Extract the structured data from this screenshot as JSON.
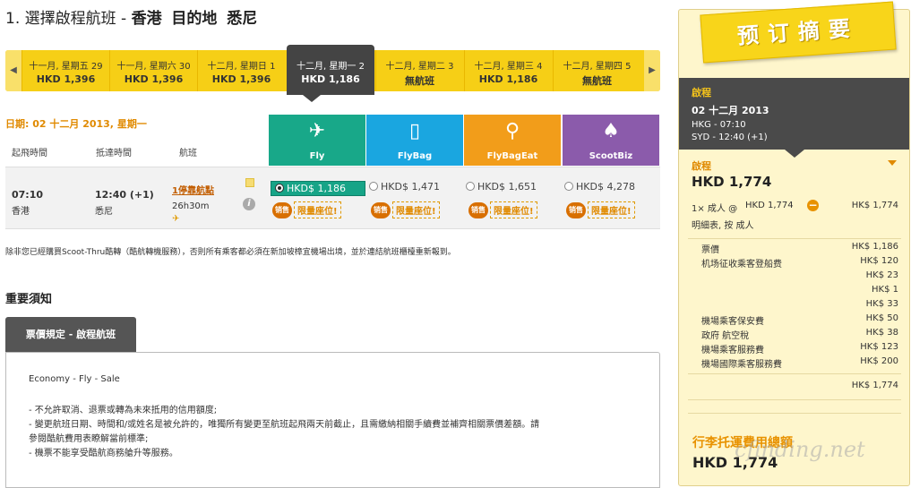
{
  "header": {
    "step": "1. 選擇啟程航班 - ",
    "origin": "香港",
    "dest_label": "目的地",
    "destination": "悉尼"
  },
  "carousel": {
    "dates": [
      {
        "date": "十一月, 星期五 29",
        "price": "HKD 1,396"
      },
      {
        "date": "十一月, 星期六 30",
        "price": "HKD 1,396"
      },
      {
        "date": "十二月, 星期日 1",
        "price": "HKD 1,396"
      },
      {
        "date": "十二月, 星期一 2",
        "price": "HKD 1,186"
      },
      {
        "date": "十二月, 星期二 3",
        "price": "無航班"
      },
      {
        "date": "十二月, 星期三 4",
        "price": "HKD 1,186"
      },
      {
        "date": "十二月, 星期四 5",
        "price": "無航班"
      }
    ],
    "selected_index": 3
  },
  "flights_section": {
    "date_line": "日期: 02 十二月 2013, 星期一",
    "col_depart": "起飛時間",
    "col_arrive": "抵達時間",
    "col_flight": "航班",
    "fare_types": [
      {
        "label": "Fly",
        "icon": "plane-icon",
        "color": "#18a889"
      },
      {
        "label": "FlyBag",
        "icon": "luggage-icon",
        "color": "#1aa6e0"
      },
      {
        "label": "FlyBagEat",
        "icon": "meal-icon",
        "color": "#f29d1a"
      },
      {
        "label": "ScootBiz",
        "icon": "seat-icon",
        "color": "#8b5bab"
      }
    ],
    "flight": {
      "depart_time": "07:10",
      "depart_city": "香港",
      "arrive_time": "12:40 (+1)",
      "arrive_city": "悉尼",
      "stops": "1停靠航點",
      "duration": "26h30m",
      "fares": [
        "HKD$ 1,186",
        "HKD$ 1,471",
        "HKD$ 1,651",
        "HKD$ 4,278"
      ],
      "selected_fare": 0,
      "sale_badge": "销售",
      "limited_seats": "限量座位!"
    },
    "disclaimer": "除非您已經購買Scoot-Thru酷轉（酷航轉機服務），否則所有乘客都必須在新加坡樟宜機場出境，並於連結航班櫃檯重新報到。"
  },
  "notice": {
    "heading": "重要須知",
    "tab": "票價規定 - 啟程航班",
    "fare_name": "Economy - Fly - Sale",
    "rules": [
      "- 不允許取消、退票或轉為未來抵用的信用額度;",
      "- 變更航班日期、時間和/或姓名是被允許的，唯獨所有變更至航班起飛兩天前截止，且需繳納相關手續費並補齊相關票價差額。請",
      "參閱酷航費用表瞭解當前標準;",
      "- 機票不能享受酷航商務艙升等服務。"
    ]
  },
  "summary": {
    "banner": "预订摘要",
    "trip_label": "啟程",
    "trip_date": "02 十二月 2013",
    "leg1": "HKG - 07:10",
    "leg2": "SYD - 12:40 (+1)",
    "section_label": "啟程",
    "section_total": "HKD 1,774",
    "pax_line_left": "1× 成人 @",
    "pax_line_mid": "HKD 1,774",
    "pax_line_right": "HK$ 1,774",
    "detail_label": "明細表, 按 成人",
    "breakdown": [
      {
        "label": "票價",
        "value": "HK$ 1,186"
      },
      {
        "label": "机场征收乘客登船费",
        "value": "HK$ 120"
      },
      {
        "label": "",
        "value": "HK$ 23"
      },
      {
        "label": "",
        "value": "HK$ 1"
      },
      {
        "label": "",
        "value": "HK$ 33"
      },
      {
        "label": "機場乘客保安費",
        "value": "HK$ 50"
      },
      {
        "label": "政府 航空稅",
        "value": "HK$ 38"
      },
      {
        "label": "機場乘客服務費",
        "value": "HK$ 123"
      },
      {
        "label": "機場國際乘客服務費",
        "value": "HK$ 200"
      }
    ],
    "breakdown_total": "HK$ 1,774",
    "grand_total_label": "行李托運費用總額",
    "grand_total": "HKD 1,774"
  },
  "watermark": "cfinding.net"
}
